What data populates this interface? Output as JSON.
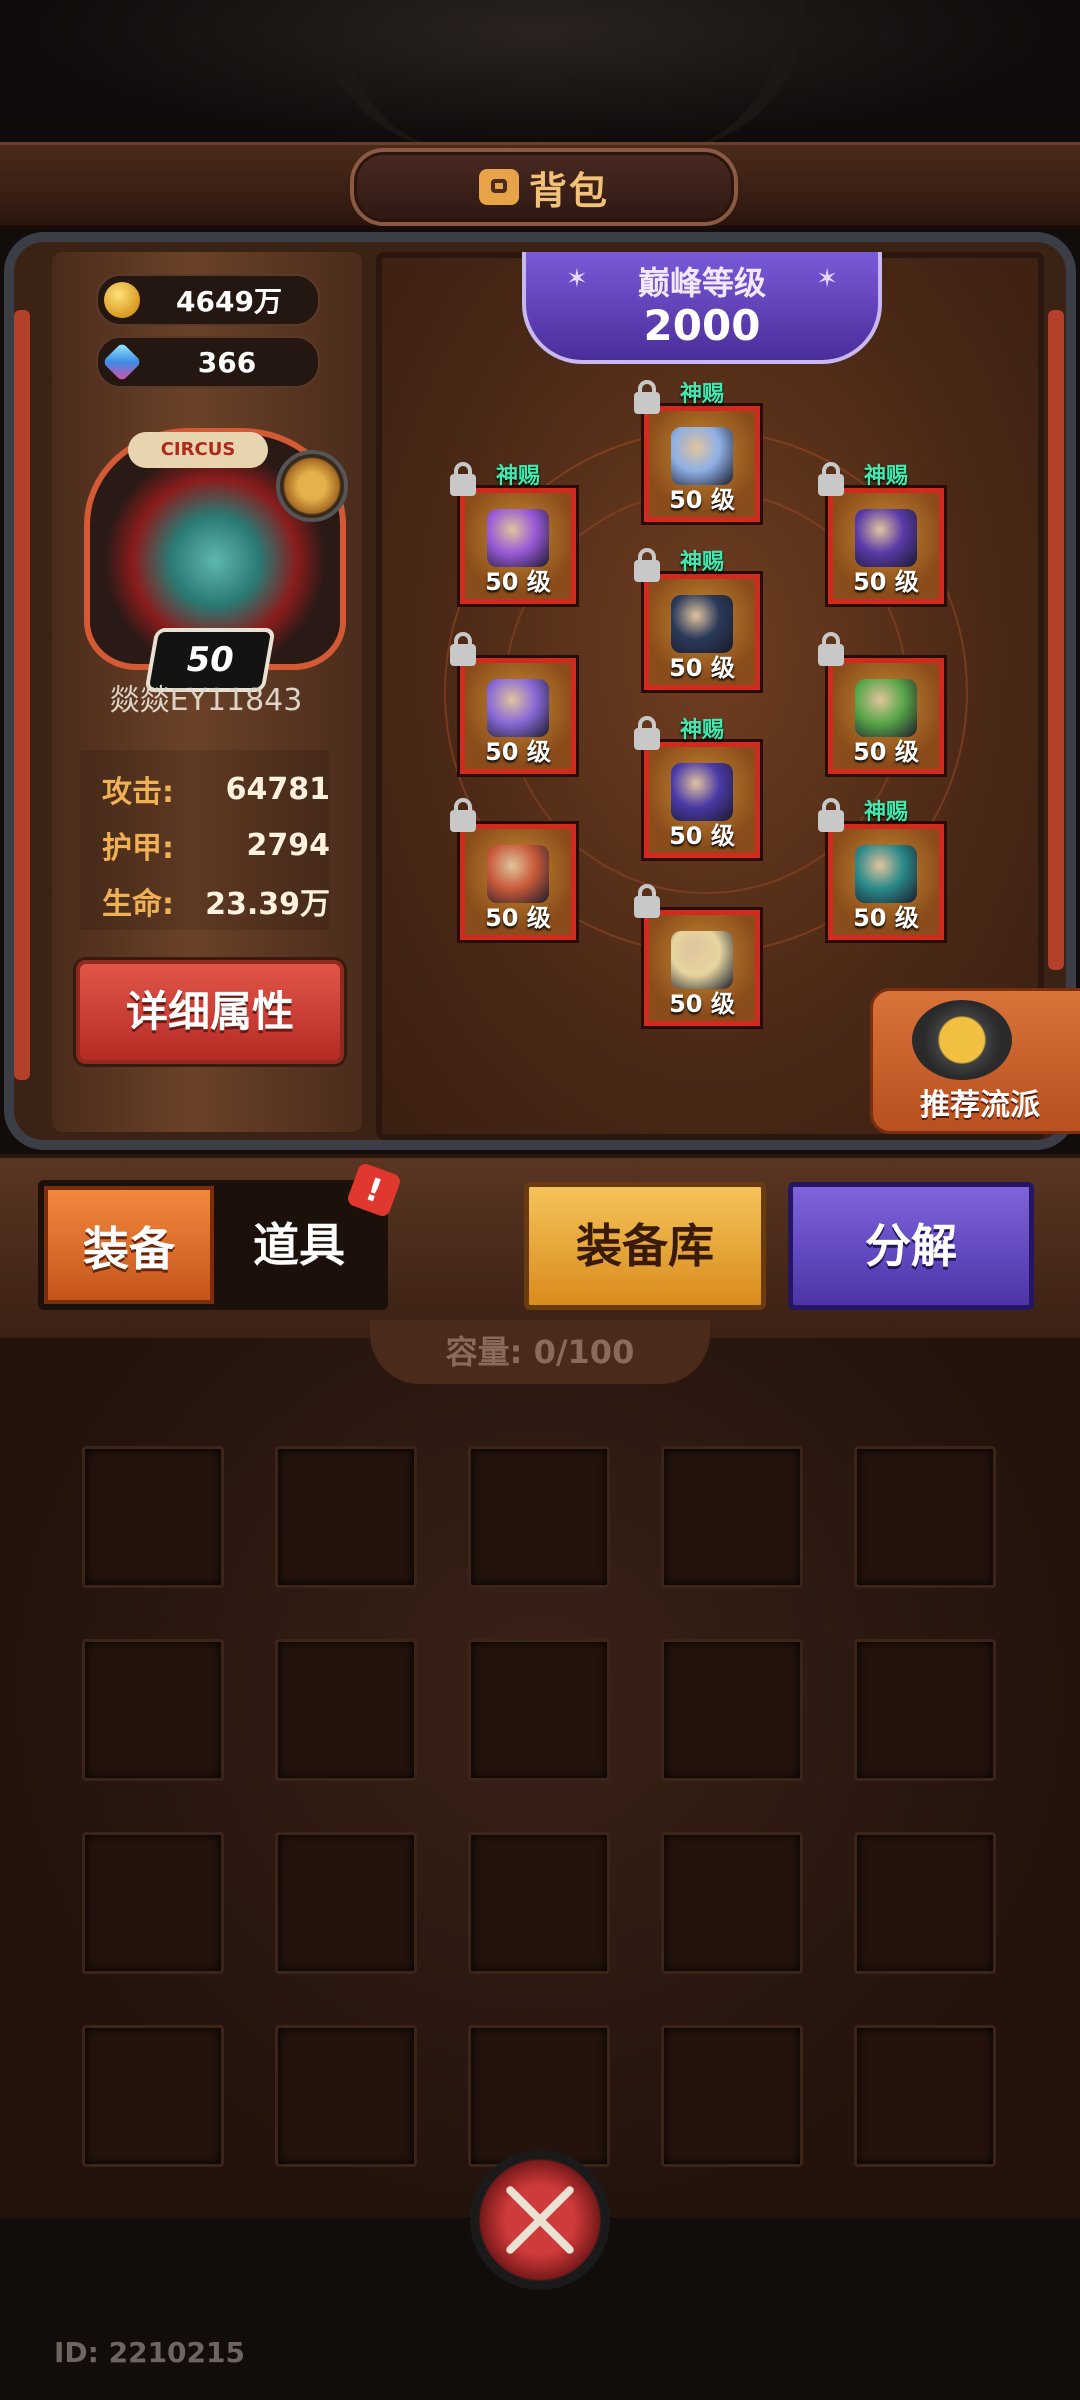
{
  "header": {
    "title": "背包",
    "icon": "bag-icon"
  },
  "currency": {
    "gold": "4649万",
    "gems": "366"
  },
  "player": {
    "avatar_sign": "CIRCUS",
    "level": "50",
    "name": "燚燚EY11843",
    "stats": [
      {
        "label": "攻击:",
        "value": "64781"
      },
      {
        "label": "护甲:",
        "value": "2794"
      },
      {
        "label": "生命:",
        "value": "23.39万"
      }
    ],
    "detail_button": "详细属性"
  },
  "peak": {
    "title": "巅峰等级",
    "value": "2000"
  },
  "equipment_slots": [
    {
      "id": "hat",
      "level": "50 级",
      "divine_label": "神赐",
      "locked": true,
      "color": "#8fb0e6"
    },
    {
      "id": "shoulder",
      "level": "50 级",
      "divine_label": "神赐",
      "locked": true,
      "color": "#9a5ad8"
    },
    {
      "id": "necklace",
      "level": "50 级",
      "divine_label": "神赐",
      "locked": true,
      "color": "#5a3aa8"
    },
    {
      "id": "armor",
      "level": "50 级",
      "divine_label": "神赐",
      "locked": true,
      "color": "#2a3a5a"
    },
    {
      "id": "gloves",
      "level": "50 级",
      "divine_label": "",
      "locked": true,
      "color": "#8a6ad8"
    },
    {
      "id": "bracelet",
      "level": "50 级",
      "divine_label": "",
      "locked": true,
      "color": "#5aa84a"
    },
    {
      "id": "pants",
      "level": "50 级",
      "divine_label": "神赐",
      "locked": true,
      "color": "#4a3aa8"
    },
    {
      "id": "weapon",
      "level": "50 级",
      "divine_label": "",
      "locked": true,
      "color": "#c85a3a"
    },
    {
      "id": "book",
      "level": "50 级",
      "divine_label": "神赐",
      "locked": true,
      "color": "#2a8a8a"
    },
    {
      "id": "boots",
      "level": "50 级",
      "divine_label": "",
      "locked": true,
      "color": "#e6d6a0"
    }
  ],
  "recommend": {
    "label": "推荐流派",
    "icon": "thumbs-up-icon"
  },
  "tabs": {
    "equipment": "装备",
    "items": "道具",
    "alert": "!"
  },
  "actions": {
    "vault": "装备库",
    "decompose": "分解"
  },
  "capacity": "容量: 0/100",
  "inventory_cells": 20,
  "footer": {
    "id": "ID: 2210215"
  }
}
